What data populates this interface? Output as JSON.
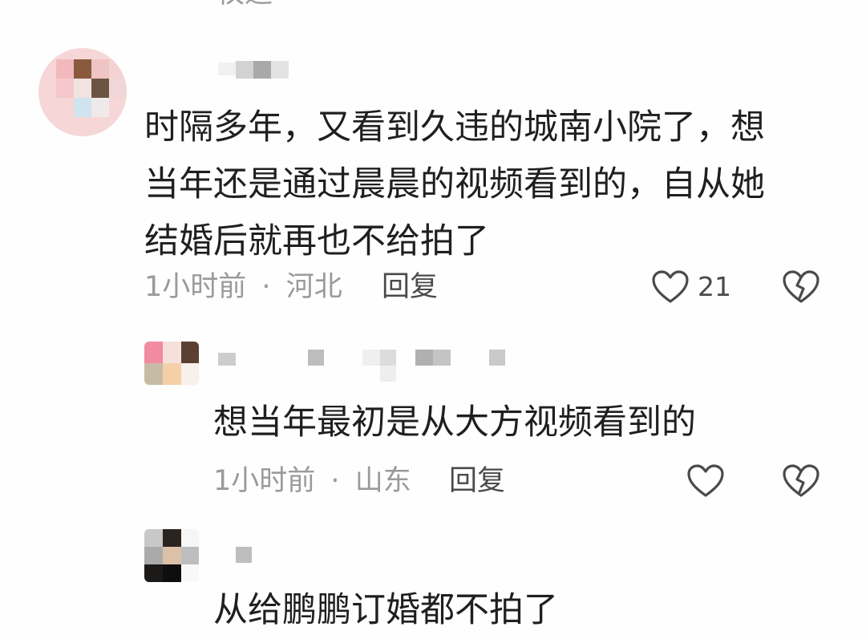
{
  "top_fragment": "衩退",
  "comments": [
    {
      "text": "时隔多年，又看到久违的城南小院了，想当年还是通过晨晨的视频看到的，自从她结婚后就再也不给拍了",
      "time": "1小时前",
      "separator": "·",
      "location": "河北",
      "reply_label": "回复",
      "like_count": "21",
      "like_icon": "heart-outline-icon",
      "dislike_icon": "broken-heart-icon"
    },
    {
      "text": "想当年最初是从大方视频看到的",
      "time": "1小时前",
      "separator": "·",
      "location": "山东",
      "reply_label": "回复",
      "like_icon": "heart-outline-icon",
      "dislike_icon": "broken-heart-icon"
    },
    {
      "text": "从给鹏鹏订婚都不拍了"
    }
  ]
}
